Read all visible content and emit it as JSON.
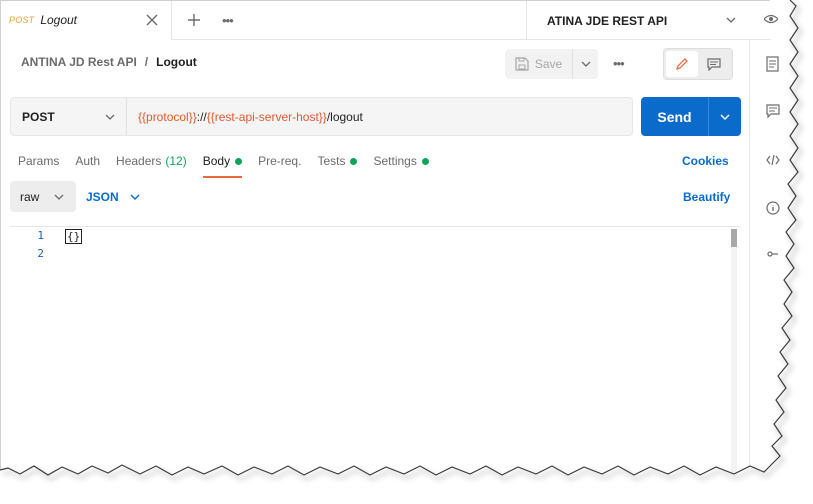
{
  "tab": {
    "method": "POST",
    "title": "Logout"
  },
  "environment": {
    "selected": "ATINA JDE REST API"
  },
  "breadcrumb": {
    "collection": "ANTINA JD Rest API",
    "separator": "/",
    "request": "Logout"
  },
  "toolbar": {
    "save_label": "Save"
  },
  "request": {
    "method": "POST",
    "url_parts": [
      "{{protocol}}",
      "://",
      "{{rest-api-server-host}}",
      "/logout"
    ],
    "send_label": "Send"
  },
  "request_tabs": {
    "params": "Params",
    "auth": "Auth",
    "headers": "Headers",
    "headers_count": "(12)",
    "body": "Body",
    "prereq": "Pre-req.",
    "tests": "Tests",
    "settings": "Settings",
    "cookies": "Cookies"
  },
  "body_mode": {
    "type": "raw",
    "language": "JSON",
    "beautify": "Beautify"
  },
  "editor": {
    "lines": [
      {
        "number": "1",
        "content": "{}"
      },
      {
        "number": "2",
        "content": ""
      }
    ]
  },
  "colors": {
    "accent": "#0b6bcb",
    "variable": "#e05a2b",
    "status_dot": "#10a35a",
    "active_tab": "#e8683a"
  }
}
